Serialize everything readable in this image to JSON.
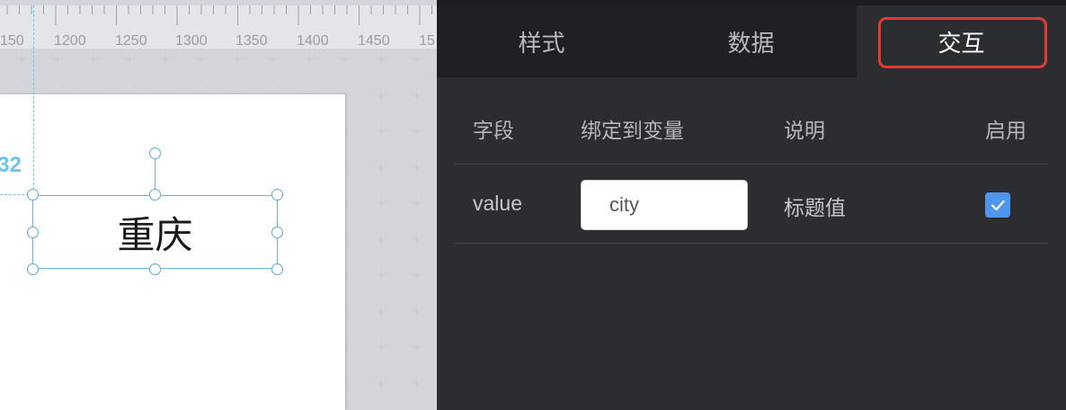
{
  "ruler": {
    "labels": [
      "150",
      "1200",
      "1250",
      "1300",
      "1350",
      "1400",
      "1450",
      "15"
    ]
  },
  "canvas": {
    "coord_readout": "32",
    "selected_text": "重庆"
  },
  "tabs": [
    {
      "label": "样式",
      "active": false
    },
    {
      "label": "数据",
      "active": false
    },
    {
      "label": "交互",
      "active": true
    }
  ],
  "table": {
    "headers": {
      "field": "字段",
      "variable": "绑定到变量",
      "description": "说明",
      "enabled": "启用"
    },
    "rows": [
      {
        "field": "value",
        "variable": "city",
        "description": "标题值",
        "enabled": true
      }
    ]
  },
  "colors": {
    "highlight": "#e53935",
    "checkbox": "#4f97ee",
    "selection": "#6bb3e0"
  }
}
